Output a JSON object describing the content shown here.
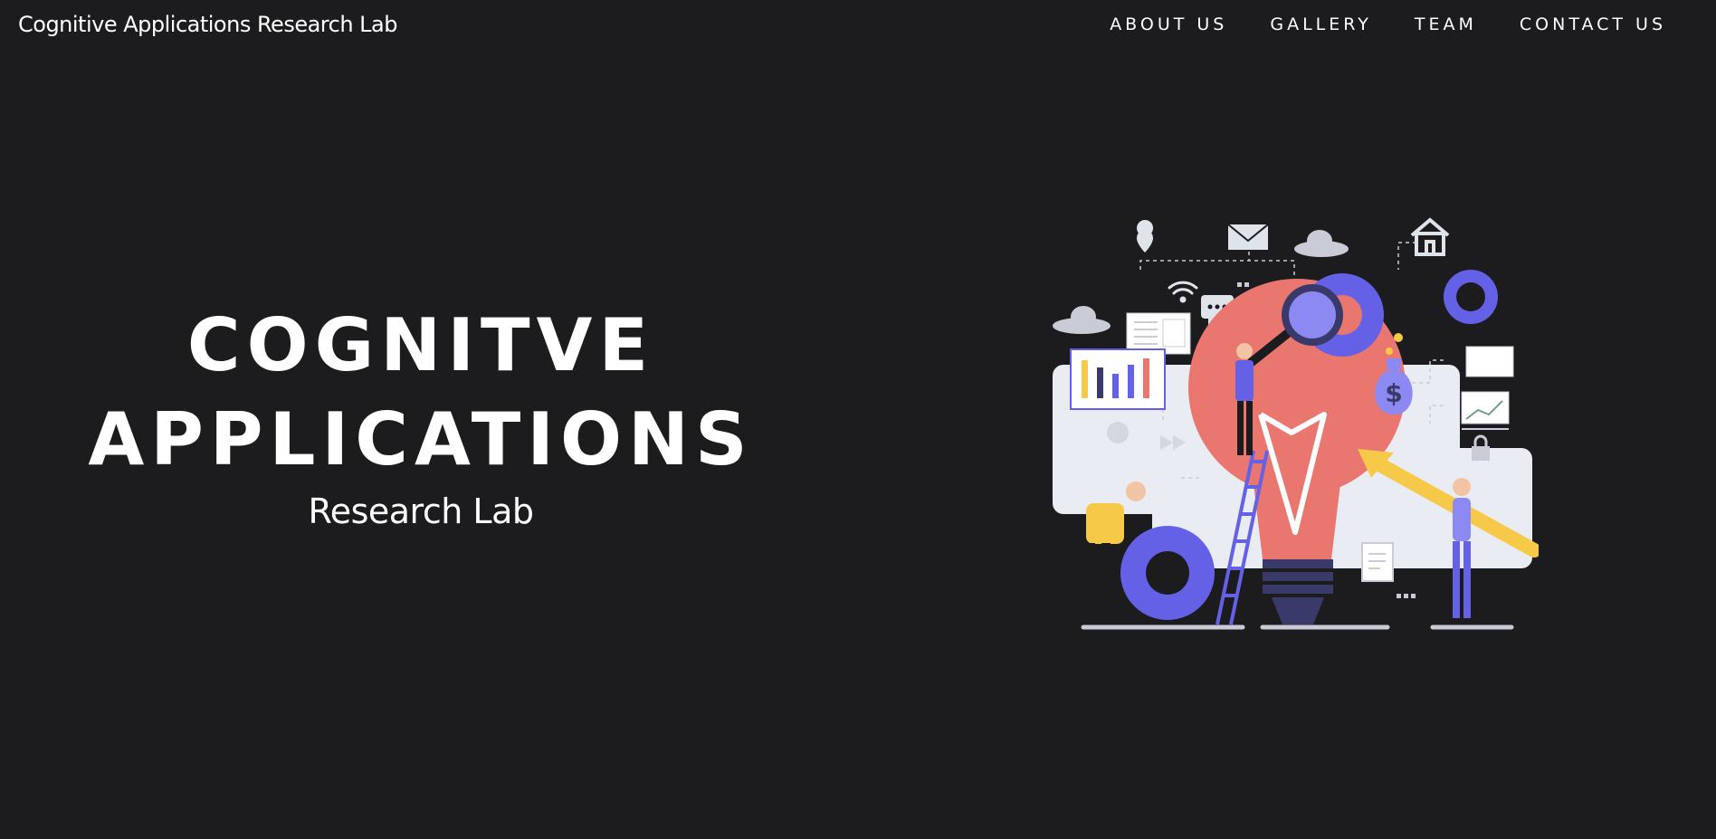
{
  "header": {
    "brand": "Cognitive Applications Research Lab",
    "nav": [
      {
        "label": "ABOUT US"
      },
      {
        "label": "GALLERY"
      },
      {
        "label": "TEAM"
      },
      {
        "label": "CONTACT US"
      }
    ]
  },
  "hero": {
    "title_line1": "COGNITVE",
    "title_line2": "APPLICATIONS",
    "subtitle": "Research Lab"
  },
  "illustration": {
    "icon": "innovation-lightbulb-illustration",
    "money_symbol": "$"
  },
  "colors": {
    "background": "#1c1c1e",
    "text": "#ffffff",
    "bulb": "#e9776f",
    "accent_purple": "#6461e6",
    "accent_yellow": "#f7c948",
    "panel": "#e9ecf2"
  }
}
